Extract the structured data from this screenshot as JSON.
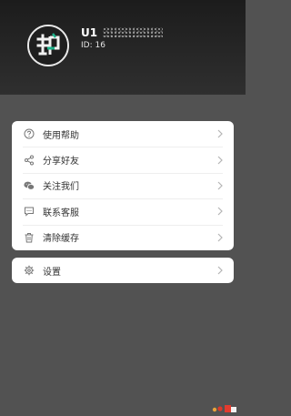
{
  "profile": {
    "username": "U1",
    "user_id": "ID: 16"
  },
  "menu": {
    "items": [
      {
        "label": "使用帮助",
        "icon": "help-circle-icon"
      },
      {
        "label": "分享好友",
        "icon": "share-icon"
      },
      {
        "label": "关注我们",
        "icon": "wechat-icon"
      },
      {
        "label": "联系客服",
        "icon": "chat-bubble-icon"
      },
      {
        "label": "清除缓存",
        "icon": "trash-icon"
      }
    ]
  },
  "settings": {
    "label": "设置",
    "icon": "gear-icon"
  },
  "colors": {
    "header_bg": "#2a2a2a",
    "page_bg": "#525252",
    "card_bg": "#ffffff",
    "text": "#333333",
    "icon": "#777777"
  }
}
